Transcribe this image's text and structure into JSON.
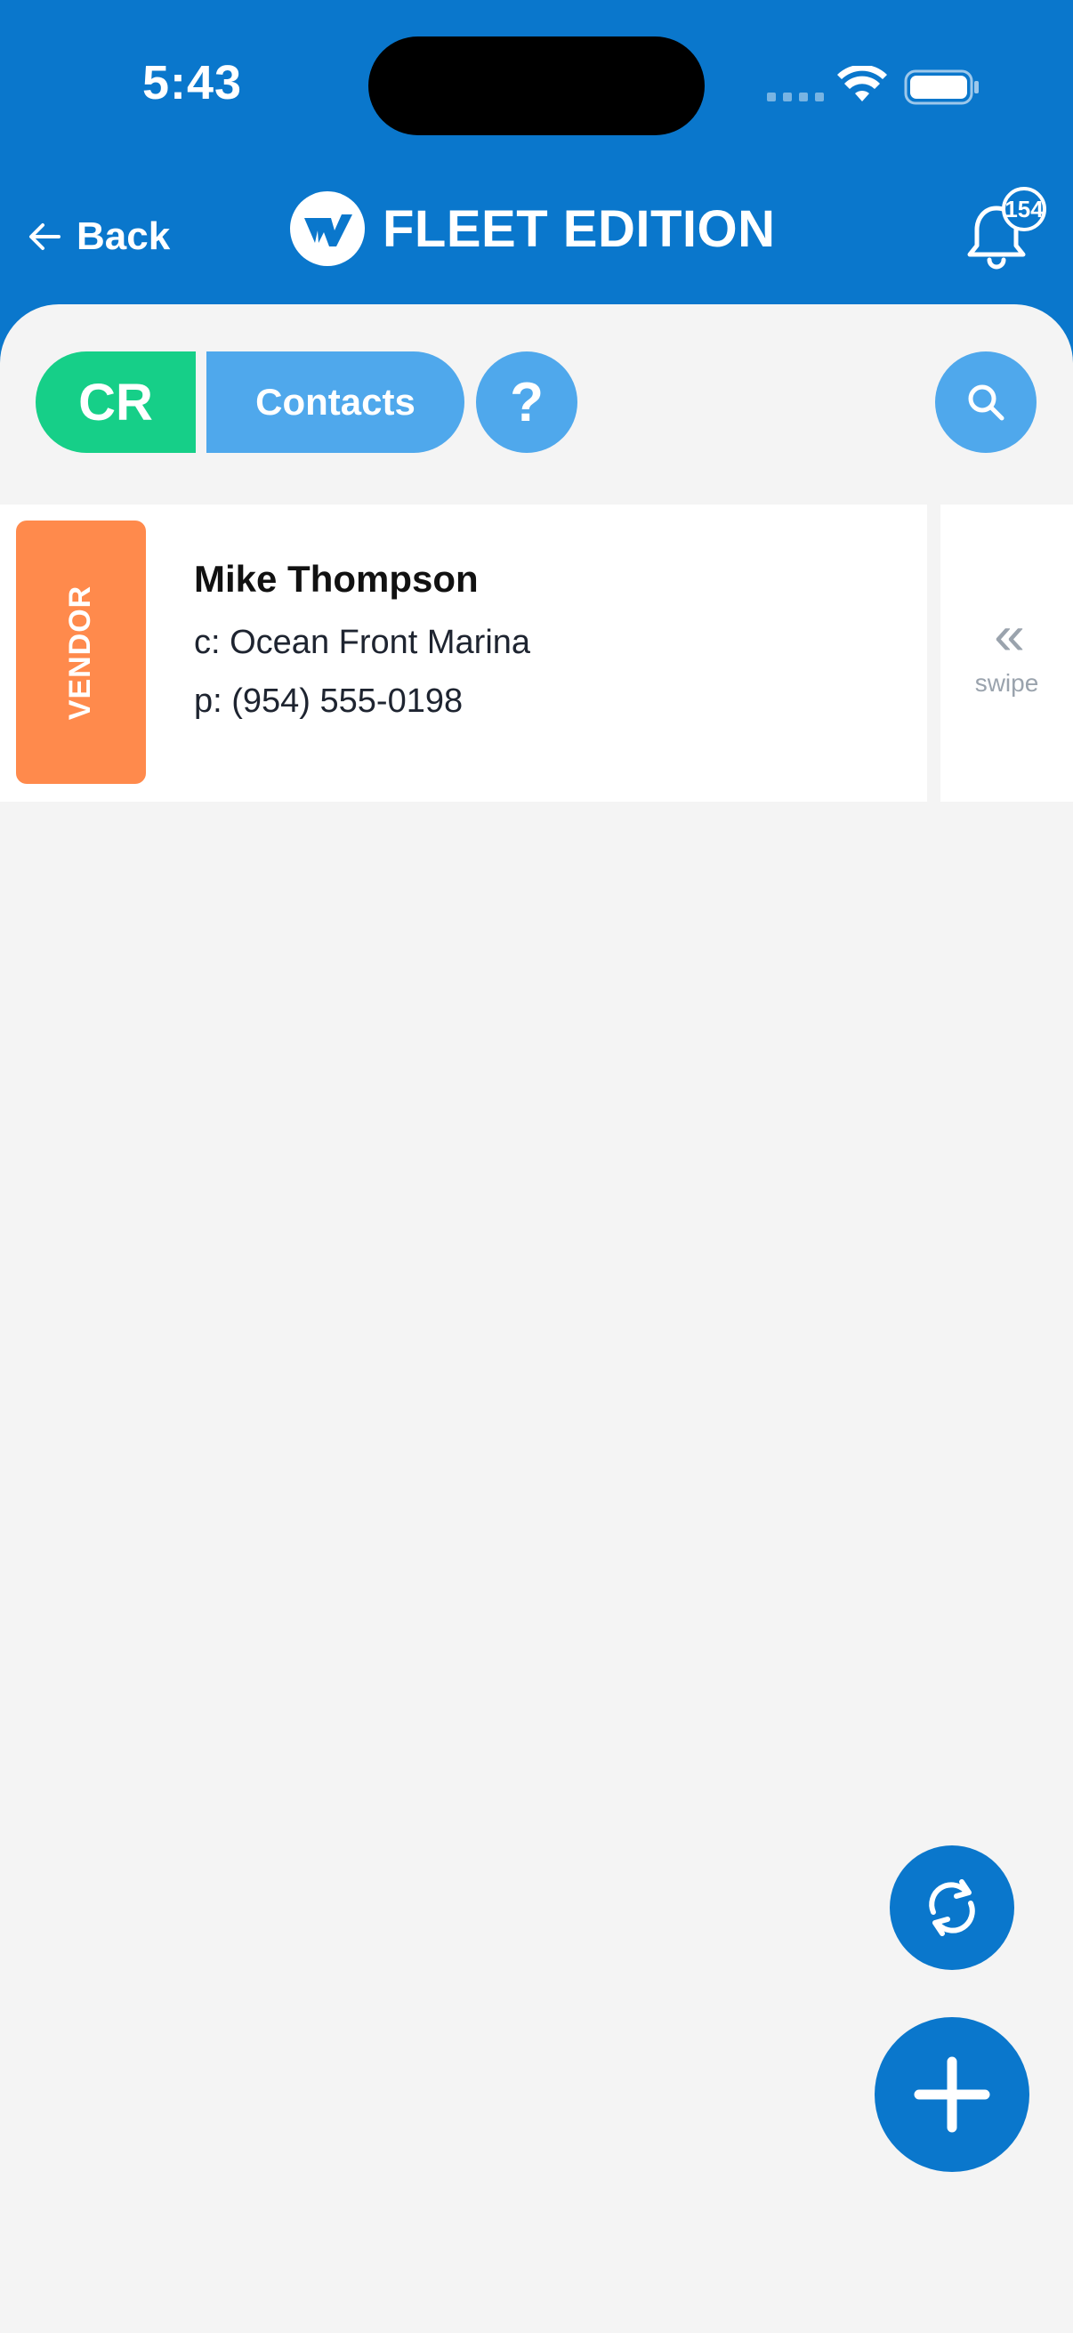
{
  "status_bar": {
    "time": "5:43"
  },
  "header": {
    "back_label": "Back",
    "brand_name": "FLEET EDITION",
    "notification_count": "154"
  },
  "toolbar": {
    "cr_label": "CR",
    "contacts_label": "Contacts",
    "help_label": "?"
  },
  "contacts": [
    {
      "type_tag": "VENDOR",
      "name": "Mike Thompson",
      "company": "c: Ocean Front Marina",
      "phone": "p: (954) 555-0198"
    }
  ],
  "swipe_hint": {
    "chevron": "«",
    "label": "swipe"
  },
  "colors": {
    "brand_blue": "#0a77cc",
    "light_blue": "#4fa8ec",
    "green": "#16cf88",
    "vendor_orange": "#ff8a4c",
    "background": "#f4f4f4"
  },
  "icons": [
    "wifi-icon",
    "battery-icon",
    "back-arrow-icon",
    "brand-logo-icon",
    "bell-icon",
    "search-icon",
    "refresh-icon",
    "plus-icon"
  ]
}
